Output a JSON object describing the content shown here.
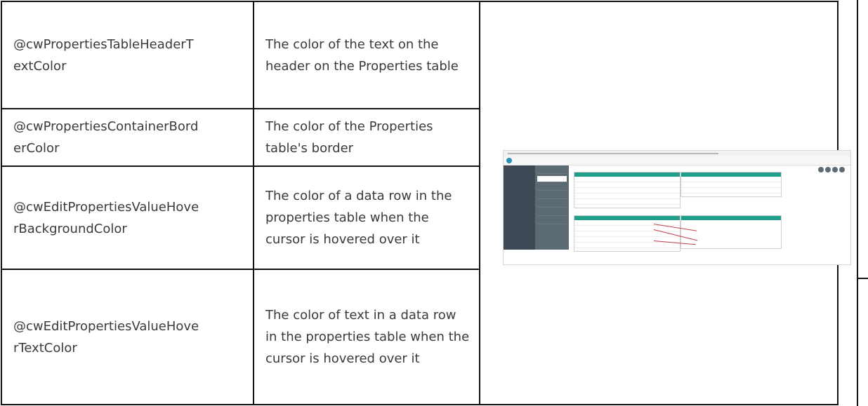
{
  "rows": [
    {
      "name": "@cwPropertiesTableHeaderT extColor",
      "description": "The color of the text on the header on the Properties table"
    },
    {
      "name": "@cwPropertiesContainerBord erColor",
      "description": "The color of the Properties table's border"
    },
    {
      "name": "@cwEditPropertiesValueHove rBackgroundColor",
      "description": "The color of a data row in the properties table when the cursor is hovered over it"
    },
    {
      "name": "@cwEditPropertiesValueHove rTextColor",
      "description": "The color of text in a data row in the properties table when the cursor is hovered over it"
    }
  ],
  "colors": {
    "border": "#111111",
    "teal_header": "#1f9e8c",
    "nav_dark": "#3d4a55",
    "nav_mid": "#5c6a73",
    "annotation": "#c2404a"
  },
  "icons": [
    "app-logo-icon",
    "action-circle-icon"
  ]
}
